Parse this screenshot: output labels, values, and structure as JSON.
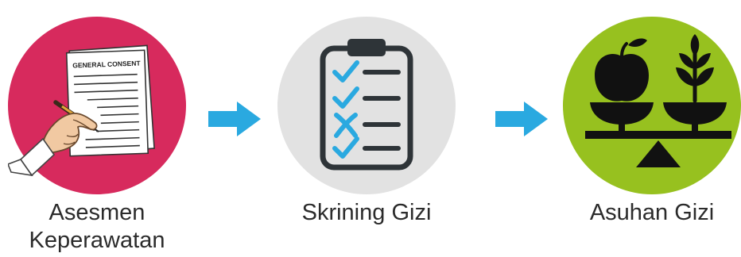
{
  "steps": [
    {
      "label_line1": "Asesmen",
      "label_line2": "Keperawatan",
      "icon": "signing-document-icon",
      "document_title": "GENERAL CONSENT",
      "color": "#d72a5d"
    },
    {
      "label": "Skrining Gizi",
      "icon": "checklist-clipboard-icon",
      "color": "#e2e2e2"
    },
    {
      "label": "Asuhan Gizi",
      "icon": "balance-scale-icon",
      "color": "#97c11f"
    }
  ],
  "arrows": [
    {
      "icon": "arrow-right-icon",
      "color": "#2aa9e0"
    },
    {
      "icon": "arrow-right-icon",
      "color": "#2aa9e0"
    }
  ]
}
